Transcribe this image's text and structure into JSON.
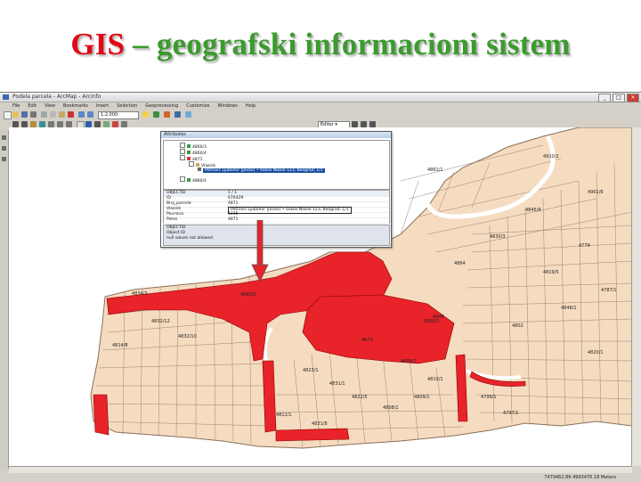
{
  "slide": {
    "title_acronym": "GIS",
    "title_rest": " – geografski informacioni sistem"
  },
  "window": {
    "title": "Podela parcela - ArcMap - ArcInfo",
    "menu": [
      "File",
      "Edit",
      "View",
      "Bookmarks",
      "Insert",
      "Selection",
      "Geoprocessing",
      "Customize",
      "Windows",
      "Help"
    ],
    "scale": "1:2,000",
    "editor": "Editor ▾",
    "status_coords": "7479462.86  4993476.18 Meters"
  },
  "attributes_panel": {
    "title": "Attributes",
    "tree": [
      {
        "text": "4860/3",
        "highlight": false
      },
      {
        "text": "4860/4",
        "highlight": false
      },
      {
        "text": "4871",
        "highlight": false
      },
      {
        "text": "Vlasnik",
        "highlight": false
      },
      {
        "text": "Petrović Ljubomir (Jovan) • Vukov Nikole 123, Beograd; 1/1",
        "highlight": true
      },
      {
        "text": "4880/4",
        "highlight": false
      }
    ],
    "grid": [
      {
        "field": "OBJECTID",
        "value": "1 / 1",
        "header": true,
        "selected": false
      },
      {
        "field": "ID",
        "value": "676429",
        "header": false,
        "selected": false
      },
      {
        "field": "Broj_parcele",
        "value": "4871",
        "header": false,
        "selected": false
      },
      {
        "field": "Vlasnik",
        "value": "Petrović Ljubomir (Jovan) • Vukov Nikole 123, Beograd; 1/1",
        "header": false,
        "selected": true
      },
      {
        "field": "Povrsina",
        "value": "1235",
        "header": false,
        "selected": false
      },
      {
        "field": "Potes",
        "value": "4871",
        "header": false,
        "selected": false
      }
    ],
    "info": [
      "OBJECTID",
      "Object ID",
      "null values not allowed"
    ]
  },
  "map_labels": [
    "4860/2",
    "4871",
    "4850/1",
    "4846",
    "4823/1",
    "4834/3",
    "4814/8",
    "4832/12",
    "4811/1",
    "4832/10",
    "4831/1",
    "4822/5",
    "4808/1",
    "4809/1",
    "4810/1",
    "4831/8",
    "4799/1",
    "4797/1",
    "4861/1",
    "4809/7",
    "4819/5",
    "4802",
    "4820/1",
    "4848/1",
    "4830/3",
    "4845/9",
    "4779",
    "4787/1",
    "4864",
    "4901/6",
    "4910/2"
  ],
  "colors": {
    "parcel": "#f5dcc0",
    "parcel_stroke": "#8a6f5a",
    "selected": "#e8232a",
    "title_red": "#e30613",
    "title_green": "#3b9b2d"
  },
  "icons": [
    "new-icon",
    "open-icon",
    "save-icon",
    "print-icon",
    "cut-icon",
    "copy-icon",
    "paste-icon",
    "delete-icon",
    "undo-icon",
    "redo-icon",
    "add-data-icon",
    "zoom-in-icon",
    "zoom-out-icon",
    "pan-icon",
    "full-extent-icon",
    "identify-icon",
    "select-icon",
    "measure-icon"
  ]
}
